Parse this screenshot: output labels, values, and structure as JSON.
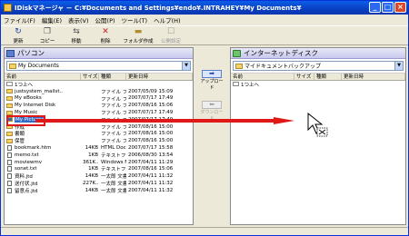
{
  "window": {
    "title": "IDiskマネージャ － C:¥Documents and Settings¥endo¥.INTRAHEY¥My Documents¥",
    "buttons": {
      "minimize": "_",
      "maximize": "□",
      "close": "×"
    }
  },
  "menu": [
    "ファイル(F)",
    "編集(E)",
    "表示(V)",
    "公開(P)",
    "ツール(T)",
    "ヘルプ(H)"
  ],
  "toolbar": [
    {
      "label": "更新",
      "icon": "refresh-icon",
      "enabled": true
    },
    {
      "label": "コピー",
      "icon": "copy-icon",
      "enabled": true
    },
    {
      "label": "移動",
      "icon": "move-icon",
      "enabled": true
    },
    {
      "label": "削除",
      "icon": "delete-icon",
      "enabled": true
    },
    {
      "label": "フォルダ作成",
      "icon": "new-folder-icon",
      "enabled": true
    },
    {
      "label": "公開設定",
      "icon": "publish-icon",
      "enabled": false
    }
  ],
  "left": {
    "title": "パソコン",
    "path": "My Documents",
    "columns": [
      "名前",
      "サイズ",
      "種類",
      "更新日時"
    ],
    "rows": [
      {
        "name": "1つ上へ",
        "size": "",
        "type": "",
        "date": "",
        "icon": "up"
      },
      {
        "name": "justsystem_mailst..",
        "size": "",
        "type": "ファイル フォル..",
        "date": "2007/05/09 15:09",
        "icon": "folder"
      },
      {
        "name": "My eBooks",
        "size": "",
        "type": "ファイル フォル..",
        "date": "2007/07/17 17:49",
        "icon": "folder"
      },
      {
        "name": "My Internet Disk",
        "size": "",
        "type": "ファイル フォル..",
        "date": "2007/08/16 15:06",
        "icon": "folder"
      },
      {
        "name": "My Music",
        "size": "",
        "type": "ファイル フォル..",
        "date": "2007/07/17 17:49",
        "icon": "folder"
      },
      {
        "name": "My Pictures",
        "size": "",
        "type": "ファイル フォル..",
        "date": "2007/07/17 17:49",
        "icon": "folder",
        "selected": true
      },
      {
        "name": "作成",
        "size": "",
        "type": "ファイル フォル..",
        "date": "2007/08/16 15:00",
        "icon": "folder"
      },
      {
        "name": "書類",
        "size": "",
        "type": "ファイル フォル..",
        "date": "2007/08/16 15:00",
        "icon": "folder"
      },
      {
        "name": "保管",
        "size": "",
        "type": "ファイル フォル..",
        "date": "2007/08/16 15:00",
        "icon": "folder"
      },
      {
        "name": "bookmark.htm",
        "size": "14KB",
        "type": "HTML Docu..",
        "date": "2007/07/17 15:58",
        "icon": "doc"
      },
      {
        "name": "memo.txt",
        "size": "1KB",
        "type": "テキストファイル",
        "date": "2006/08/30 13:54",
        "icon": "doc"
      },
      {
        "name": "moviewmv",
        "size": "361K..",
        "type": "Windows Me..",
        "date": "2007/04/11 11:29",
        "icon": "doc"
      },
      {
        "name": "sonet.txt",
        "size": "1KB",
        "type": "テキストファイル",
        "date": "2007/08/16 15:06",
        "icon": "doc"
      },
      {
        "name": "資料.jtd",
        "size": "14KB",
        "type": "一太郎 文書",
        "date": "2007/04/11 11:32",
        "icon": "doc"
      },
      {
        "name": "送付状.jtd",
        "size": "227K..",
        "type": "一太郎 文書",
        "date": "2007/04/11 11:32",
        "icon": "doc"
      },
      {
        "name": "留意点.jtd",
        "size": "14KB",
        "type": "一太郎 文書",
        "date": "2007/04/11 11:32",
        "icon": "doc"
      }
    ]
  },
  "transfer": {
    "upload": "アップロード",
    "download": "ダウンロード"
  },
  "right": {
    "title": "インターネットディスク",
    "path": "マイドキュメントバックアップ",
    "columns": [
      "名前",
      "サイズ",
      "種類",
      "更新日時"
    ],
    "rows": [
      {
        "name": "1つ上へ",
        "icon": "up"
      }
    ]
  },
  "colors": {
    "highlight": "#e01818",
    "arrow": "#e01818",
    "titlebar": "#0a3fc0"
  }
}
